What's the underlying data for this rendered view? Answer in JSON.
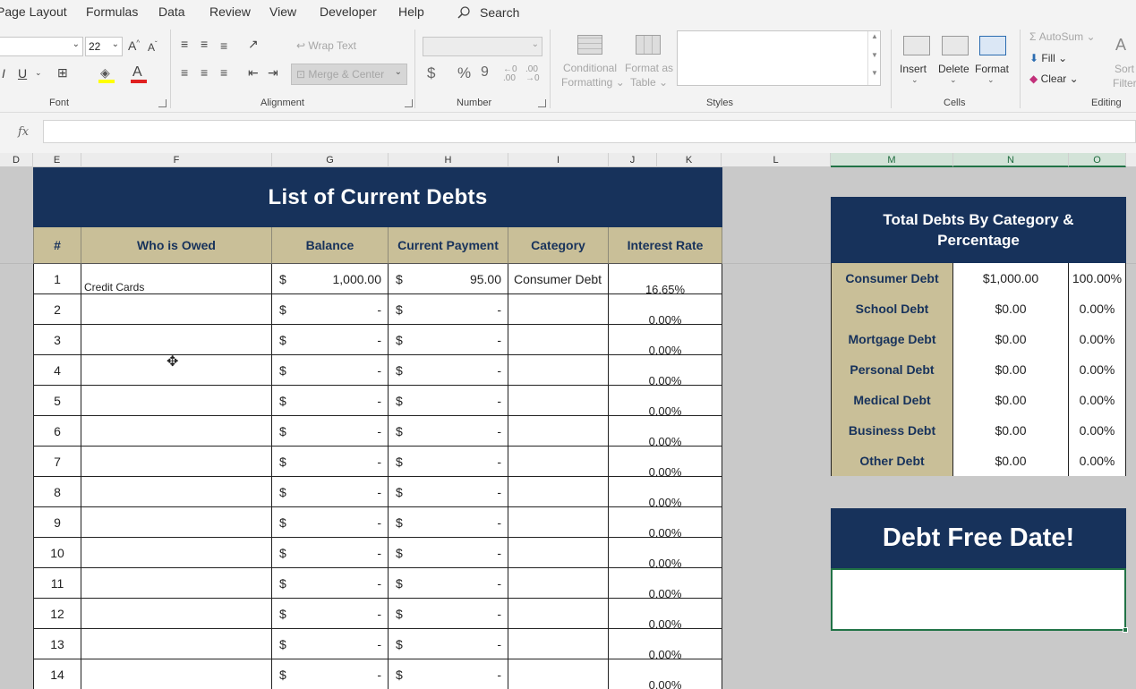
{
  "menu": {
    "items": [
      "Page Layout",
      "Formulas",
      "Data",
      "Review",
      "View",
      "Developer",
      "Help"
    ],
    "search_label": "Search"
  },
  "ribbon": {
    "font": {
      "name": "",
      "size": "22",
      "label": "Font",
      "grow_icon": "A^",
      "shrink_icon": "Aˇ",
      "italic": "I",
      "underline": "U",
      "font_color_icon": "A"
    },
    "alignment": {
      "label": "Alignment",
      "wrap_text": "Wrap Text",
      "merge_center": "Merge & Center"
    },
    "number": {
      "label": "Number",
      "format": "",
      "currency": "$",
      "percent": "%",
      "comma": "9",
      "inc_decimal": "←0\n.00",
      "dec_decimal": ".00\n→0"
    },
    "styles": {
      "label": "Styles",
      "conditional_formatting": [
        "Conditional",
        "Formatting"
      ],
      "format_as_table": [
        "Format as",
        "Table"
      ]
    },
    "cells": {
      "label": "Cells",
      "insert": "Insert",
      "delete": "Delete",
      "format": "Format"
    },
    "editing": {
      "label": "Editing",
      "autosum": "AutoSum",
      "fill": "Fill",
      "clear": "Clear",
      "sort": "Sort",
      "filter": "Filter"
    }
  },
  "formula_bar": {
    "fx": "fx",
    "value": ""
  },
  "columns": [
    "D",
    "E",
    "F",
    "G",
    "H",
    "I",
    "J",
    "K",
    "L",
    "M",
    "N",
    "O"
  ],
  "debt_table": {
    "title": "List of Current Debts",
    "headers": [
      "#",
      "Who is Owed",
      "Balance",
      "Current Payment",
      "Category",
      "Interest Rate"
    ],
    "rows": [
      {
        "num": "1",
        "who": "Credit Cards",
        "bal_sign": "$",
        "balance": "1,000.00",
        "pay_sign": "$",
        "payment": "95.00",
        "category": "Consumer Debt",
        "rate": "16.65%"
      },
      {
        "num": "2",
        "who": "",
        "bal_sign": "$",
        "balance": "-",
        "pay_sign": "$",
        "payment": "-",
        "category": "",
        "rate": "0.00%"
      },
      {
        "num": "3",
        "who": "",
        "bal_sign": "$",
        "balance": "-",
        "pay_sign": "$",
        "payment": "-",
        "category": "",
        "rate": "0.00%"
      },
      {
        "num": "4",
        "who": "",
        "bal_sign": "$",
        "balance": "-",
        "pay_sign": "$",
        "payment": "-",
        "category": "",
        "rate": "0.00%"
      },
      {
        "num": "5",
        "who": "",
        "bal_sign": "$",
        "balance": "-",
        "pay_sign": "$",
        "payment": "-",
        "category": "",
        "rate": "0.00%"
      },
      {
        "num": "6",
        "who": "",
        "bal_sign": "$",
        "balance": "-",
        "pay_sign": "$",
        "payment": "-",
        "category": "",
        "rate": "0.00%"
      },
      {
        "num": "7",
        "who": "",
        "bal_sign": "$",
        "balance": "-",
        "pay_sign": "$",
        "payment": "-",
        "category": "",
        "rate": "0.00%"
      },
      {
        "num": "8",
        "who": "",
        "bal_sign": "$",
        "balance": "-",
        "pay_sign": "$",
        "payment": "-",
        "category": "",
        "rate": "0.00%"
      },
      {
        "num": "9",
        "who": "",
        "bal_sign": "$",
        "balance": "-",
        "pay_sign": "$",
        "payment": "-",
        "category": "",
        "rate": "0.00%"
      },
      {
        "num": "10",
        "who": "",
        "bal_sign": "$",
        "balance": "-",
        "pay_sign": "$",
        "payment": "-",
        "category": "",
        "rate": "0.00%"
      },
      {
        "num": "11",
        "who": "",
        "bal_sign": "$",
        "balance": "-",
        "pay_sign": "$",
        "payment": "-",
        "category": "",
        "rate": "0.00%"
      },
      {
        "num": "12",
        "who": "",
        "bal_sign": "$",
        "balance": "-",
        "pay_sign": "$",
        "payment": "-",
        "category": "",
        "rate": "0.00%"
      },
      {
        "num": "13",
        "who": "",
        "bal_sign": "$",
        "balance": "-",
        "pay_sign": "$",
        "payment": "-",
        "category": "",
        "rate": "0.00%"
      },
      {
        "num": "14",
        "who": "",
        "bal_sign": "$",
        "balance": "-",
        "pay_sign": "$",
        "payment": "-",
        "category": "",
        "rate": "0.00%"
      }
    ]
  },
  "category_summary": {
    "title": "Total Debts By Category & Percentage",
    "rows": [
      {
        "name": "Consumer Debt",
        "amount": "$1,000.00",
        "pct": "100.00%"
      },
      {
        "name": "School Debt",
        "amount": "$0.00",
        "pct": "0.00%"
      },
      {
        "name": "Mortgage Debt",
        "amount": "$0.00",
        "pct": "0.00%"
      },
      {
        "name": "Personal Debt",
        "amount": "$0.00",
        "pct": "0.00%"
      },
      {
        "name": "Medical Debt",
        "amount": "$0.00",
        "pct": "0.00%"
      },
      {
        "name": "Business Debt",
        "amount": "$0.00",
        "pct": "0.00%"
      },
      {
        "name": "Other Debt",
        "amount": "$0.00",
        "pct": "0.00%"
      }
    ]
  },
  "debt_free": {
    "title": "Debt Free Date!",
    "value": ""
  },
  "colors": {
    "navy": "#17325b",
    "tan": "#c9bf98",
    "excel_green": "#217346"
  }
}
